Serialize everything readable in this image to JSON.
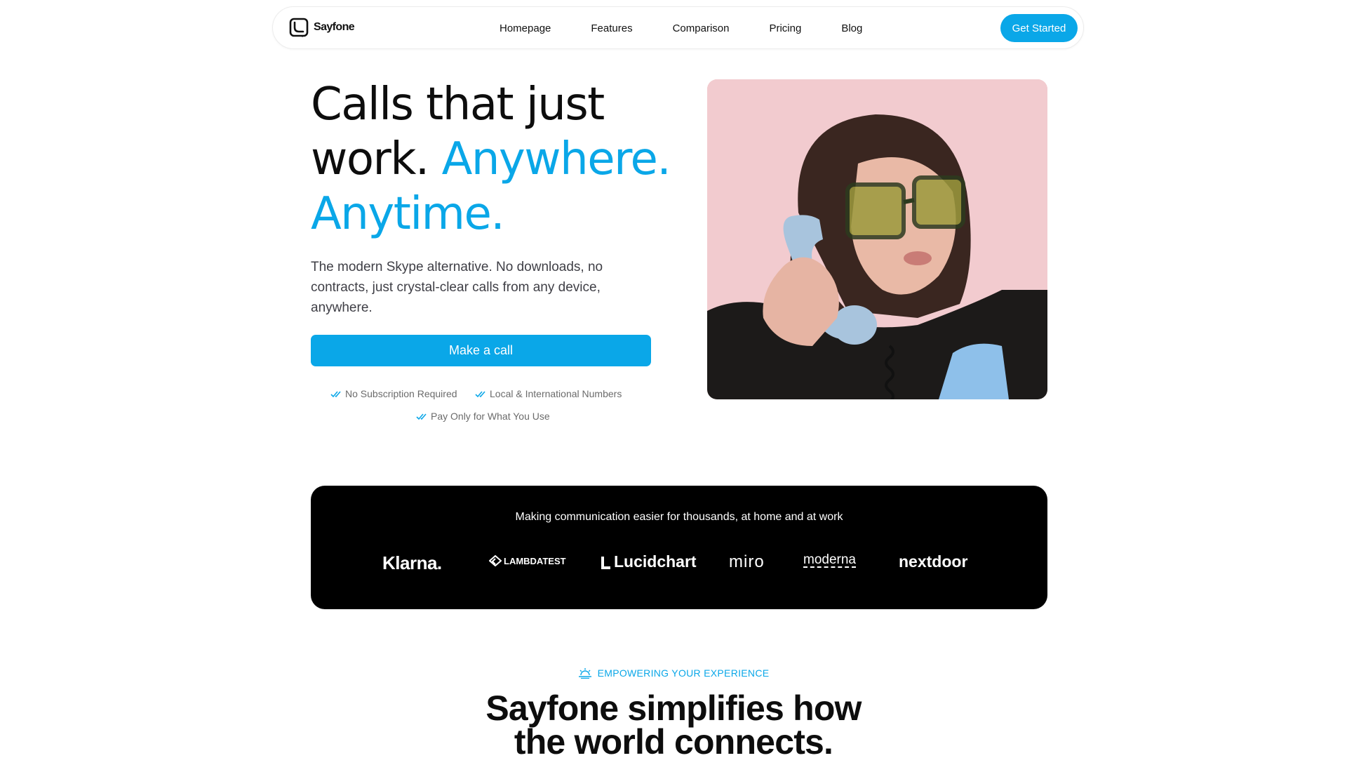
{
  "brand": {
    "name": "Sayfone",
    "logo_icon": "sayfone-logo-icon"
  },
  "nav": {
    "links": [
      "Homepage",
      "Features",
      "Comparison",
      "Pricing",
      "Blog"
    ],
    "cta_label": "Get Started"
  },
  "hero": {
    "title_line1": "Calls that just",
    "title_line2_dark": "work.",
    "title_line2_accent": "Anywhere.",
    "title_line3_accent": "Anytime.",
    "subtitle": "The modern Skype alternative. No downloads, no contracts, just crystal-clear calls from any device, anywhere.",
    "cta_label": "Make a call",
    "perks": [
      "No Subscription Required",
      "Local & International Numbers",
      "Pay Only for What You Use"
    ],
    "photo_icon": "woman-on-phone-photo"
  },
  "logo_band": {
    "text": "Making communication easier for thousands, at home and at work",
    "brands": [
      "Klarna.",
      "LAMBDATEST",
      "Lucidchart",
      "miro",
      "moderna",
      "nextdoor"
    ]
  },
  "section": {
    "eyebrow": "EMPOWERING YOUR EXPERIENCE",
    "title_line1": "Sayfone simplifies how",
    "title_line2": "the world connects."
  },
  "colors": {
    "accent": "#0aa7e8",
    "dark": "#0d0d0d",
    "band": "#000000"
  }
}
